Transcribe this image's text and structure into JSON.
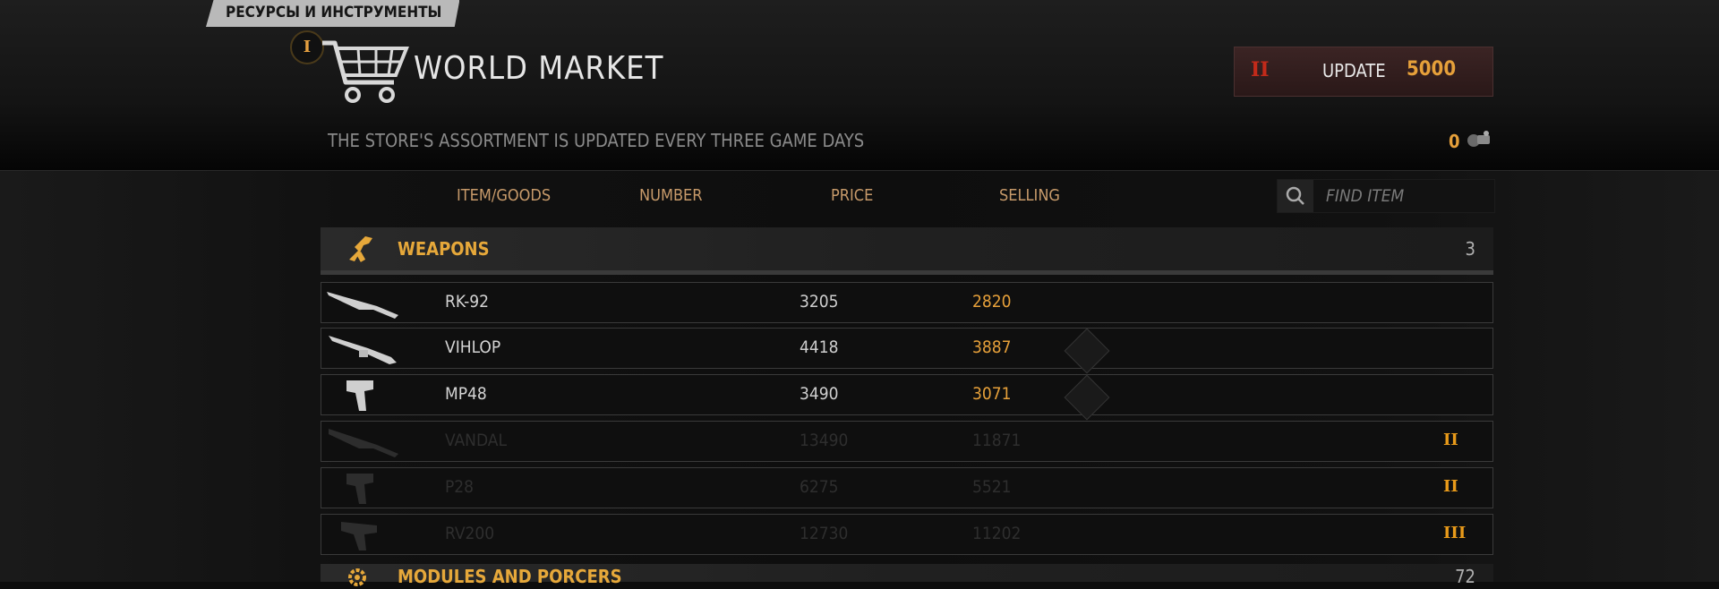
{
  "header": {
    "resource_tab": "РЕСУРСЫ И ИНСТРУМЕНТЫ",
    "tier_badge": "I",
    "title": "WORLD MARKET",
    "subtitle": "THE STORE'S ASSORTMENT IS UPDATED EVERY THREE GAME DAYS",
    "update": {
      "tier": "II",
      "label": "UPDATE",
      "cost": "5000"
    },
    "currency_count": "0"
  },
  "columns": {
    "item": "ITEM/GOODS",
    "number": "NUMBER",
    "price": "PRICE",
    "selling": "SELLING"
  },
  "search": {
    "placeholder": "FIND ITEM"
  },
  "categories": [
    {
      "name": "WEAPONS",
      "count": "3",
      "items": [
        {
          "name": "RK-92",
          "number": "3205",
          "price": "2820",
          "tier": ""
        },
        {
          "name": "VIHLOP",
          "number": "4418",
          "price": "3887",
          "tier": ""
        },
        {
          "name": "MP48",
          "number": "3490",
          "price": "3071",
          "tier": ""
        },
        {
          "name": "VANDAL",
          "number": "13490",
          "price": "11871",
          "tier": "II"
        },
        {
          "name": "P28",
          "number": "6275",
          "price": "5521",
          "tier": "II"
        },
        {
          "name": "RV200",
          "number": "12730",
          "price": "11202",
          "tier": "III"
        }
      ]
    },
    {
      "name": "MODULES AND PORCERS",
      "count": "72"
    }
  ],
  "colors": {
    "accent": "#e6a03a",
    "tier_red": "#c22a1a"
  },
  "icons": [
    "cart-icon",
    "search-icon",
    "rifle-icon",
    "pistol-icon",
    "gear-icon",
    "parts-icon"
  ]
}
